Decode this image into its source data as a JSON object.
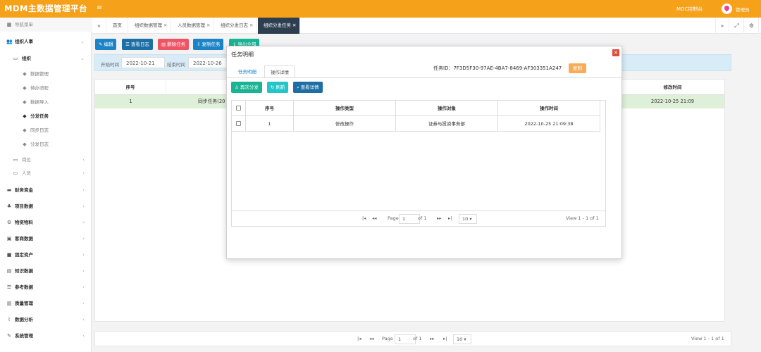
{
  "app": {
    "brand": "MDM主数据管理平台",
    "top_link": "MOC控制台",
    "user_name": "管理员",
    "colors": {
      "brand": "#f5a11a",
      "active_tab": "#2d3e50",
      "row_highlight": "#dff0d8"
    }
  },
  "sidebar": {
    "header": "导航菜单",
    "items": [
      {
        "icon": "users-icon",
        "label": "组织人事"
      },
      {
        "icon": "folder-icon",
        "label": "组织"
      },
      {
        "icon": "tag-icon",
        "label": "数据管理"
      },
      {
        "icon": "tag-icon",
        "label": "待办流程"
      },
      {
        "icon": "tag-icon",
        "label": "数据导入"
      },
      {
        "icon": "tag-icon",
        "label": "分发任务"
      },
      {
        "icon": "tag-icon",
        "label": "同步日志"
      },
      {
        "icon": "tag-icon",
        "label": "分发日志"
      },
      {
        "icon": "folder-icon",
        "label": "岗位"
      },
      {
        "icon": "folder-icon",
        "label": "人员"
      },
      {
        "icon": "card-icon",
        "label": "财务资金"
      },
      {
        "icon": "sitemap-icon",
        "label": "项目数据"
      },
      {
        "icon": "cart-icon",
        "label": "物资物料"
      },
      {
        "icon": "customer-icon",
        "label": "客商数据"
      },
      {
        "icon": "asset-icon",
        "label": "固定资产"
      },
      {
        "icon": "book-icon",
        "label": "知识数据"
      },
      {
        "icon": "list-icon",
        "label": "参考数据"
      },
      {
        "icon": "layers-icon",
        "label": "质量管理"
      },
      {
        "icon": "chart-icon",
        "label": "数据分析"
      },
      {
        "icon": "wrench-icon",
        "label": "系统管理"
      }
    ]
  },
  "tabs": {
    "nav_prev": "«",
    "nav_next": "»",
    "items": [
      {
        "label": "首页"
      },
      {
        "label": "组织数据管理"
      },
      {
        "label": "人员数据管理"
      },
      {
        "label": "组织分发日志"
      },
      {
        "label": "组织分发任务"
      }
    ]
  },
  "toolbar": {
    "edit": "编辑",
    "view_log": "查看日志",
    "delete_task": "删除任务",
    "copy_task": "复制任务",
    "export": "导出全部"
  },
  "search": {
    "start_label": "开始时间",
    "start_value": "2022-10-21",
    "end_label": "结束时间",
    "end_value": "2022-10-26"
  },
  "main_table": {
    "columns": [
      "序号",
      "修改时间"
    ],
    "rows": [
      {
        "index": "1",
        "name": "同步任务(20",
        "modified": "2022-10-25 21:09"
      }
    ]
  },
  "pager": {
    "page_label": "Page",
    "page_value": "1",
    "of_label": "of 1",
    "page_size": "10",
    "view": "View 1 - 1 of 1"
  },
  "modal": {
    "title": "任务明细",
    "tabs": [
      "任务明细",
      "操作详情"
    ],
    "task_id": "任务ID：7F3D5F30-97AE-4BA7-8469-AF303351A247",
    "copy": "复制",
    "buttons": {
      "redistribute": "再次分发",
      "refresh": "刷新",
      "view_detail": "查看详情"
    },
    "columns": [
      "序号",
      "操作类型",
      "操作对象",
      "操作时间"
    ],
    "rows": [
      {
        "index": "1",
        "type": "修改操作",
        "target": "证券与投资事务部",
        "time": "2022-10-25 21:09:38"
      }
    ],
    "pager": {
      "page_label": "Page",
      "page_value": "1",
      "of_label": "of 1",
      "page_size": "10",
      "view": "View 1 - 1 of 1"
    }
  }
}
